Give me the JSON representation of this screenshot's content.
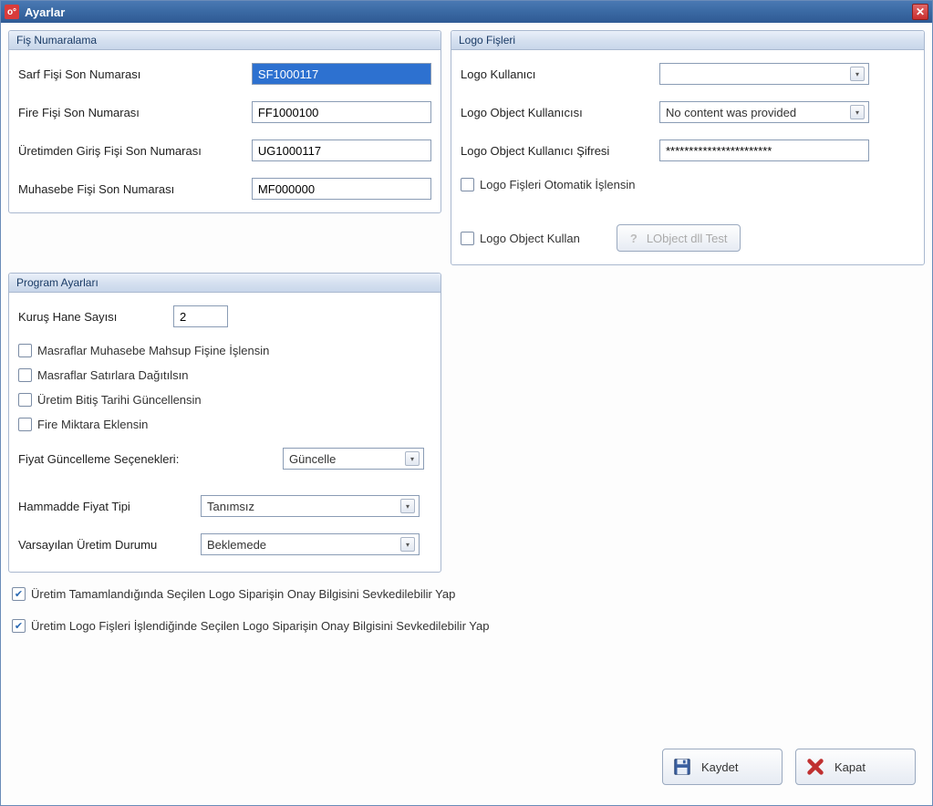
{
  "window": {
    "title": "Ayarlar"
  },
  "fis_numaralama": {
    "title": "Fiş Numaralama",
    "sarf_label": "Sarf Fişi Son Numarası",
    "sarf_value": "SF1000117",
    "fire_label": "Fire Fişi  Son Numarası",
    "fire_value": "FF1000100",
    "uretim_label": "Üretimden Giriş Fişi Son Numarası",
    "uretim_value": "UG1000117",
    "muhasebe_label": "Muhasebe Fişi Son Numarası",
    "muhasebe_value": "MF000000"
  },
  "logo_fisleri": {
    "title": "Logo Fişleri",
    "kullanici_label": "Logo Kullanıcı",
    "kullanici_value": "",
    "obj_kullanici_label": "Logo Object Kullanıcısı",
    "obj_kullanici_value": "No content was provided",
    "obj_sifre_label": "Logo Object Kullanıcı Şifresi",
    "obj_sifre_value": "***********************",
    "auto_process_label": "Logo Fişleri Otomatik İşlensin",
    "obj_kullan_label": "Logo Object Kullan",
    "test_btn": "LObject dll Test"
  },
  "program_ayarlari": {
    "title": "Program Ayarları",
    "kurus_label": "Kuruş Hane Sayısı",
    "kurus_value": "2",
    "chk_masraf_muhasebe": "Masraflar Muhasebe Mahsup Fişine İşlensin",
    "chk_masraf_satir": "Masraflar Satırlara Dağıtılsın",
    "chk_bitis_tarihi": "Üretim Bitiş Tarihi Güncellensin",
    "chk_fire_miktar": "Fire Miktara Eklensin",
    "fiyat_guncelleme_label": "Fiyat Güncelleme Seçenekleri:",
    "fiyat_guncelleme_value": "Güncelle",
    "hammadde_label": "Hammadde Fiyat Tipi",
    "hammadde_value": "Tanımsız",
    "varsayilan_label": "Varsayılan Üretim Durumu",
    "varsayilan_value": "Beklemede"
  },
  "lower": {
    "chk1": "Üretim Tamamlandığında Seçilen Logo Siparişin Onay Bilgisini Sevkedilebilir Yap",
    "chk2": "Üretim Logo Fişleri İşlendiğinde  Seçilen Logo Siparişin Onay Bilgisini Sevkedilebilir Yap"
  },
  "footer": {
    "save": "Kaydet",
    "close": "Kapat"
  }
}
